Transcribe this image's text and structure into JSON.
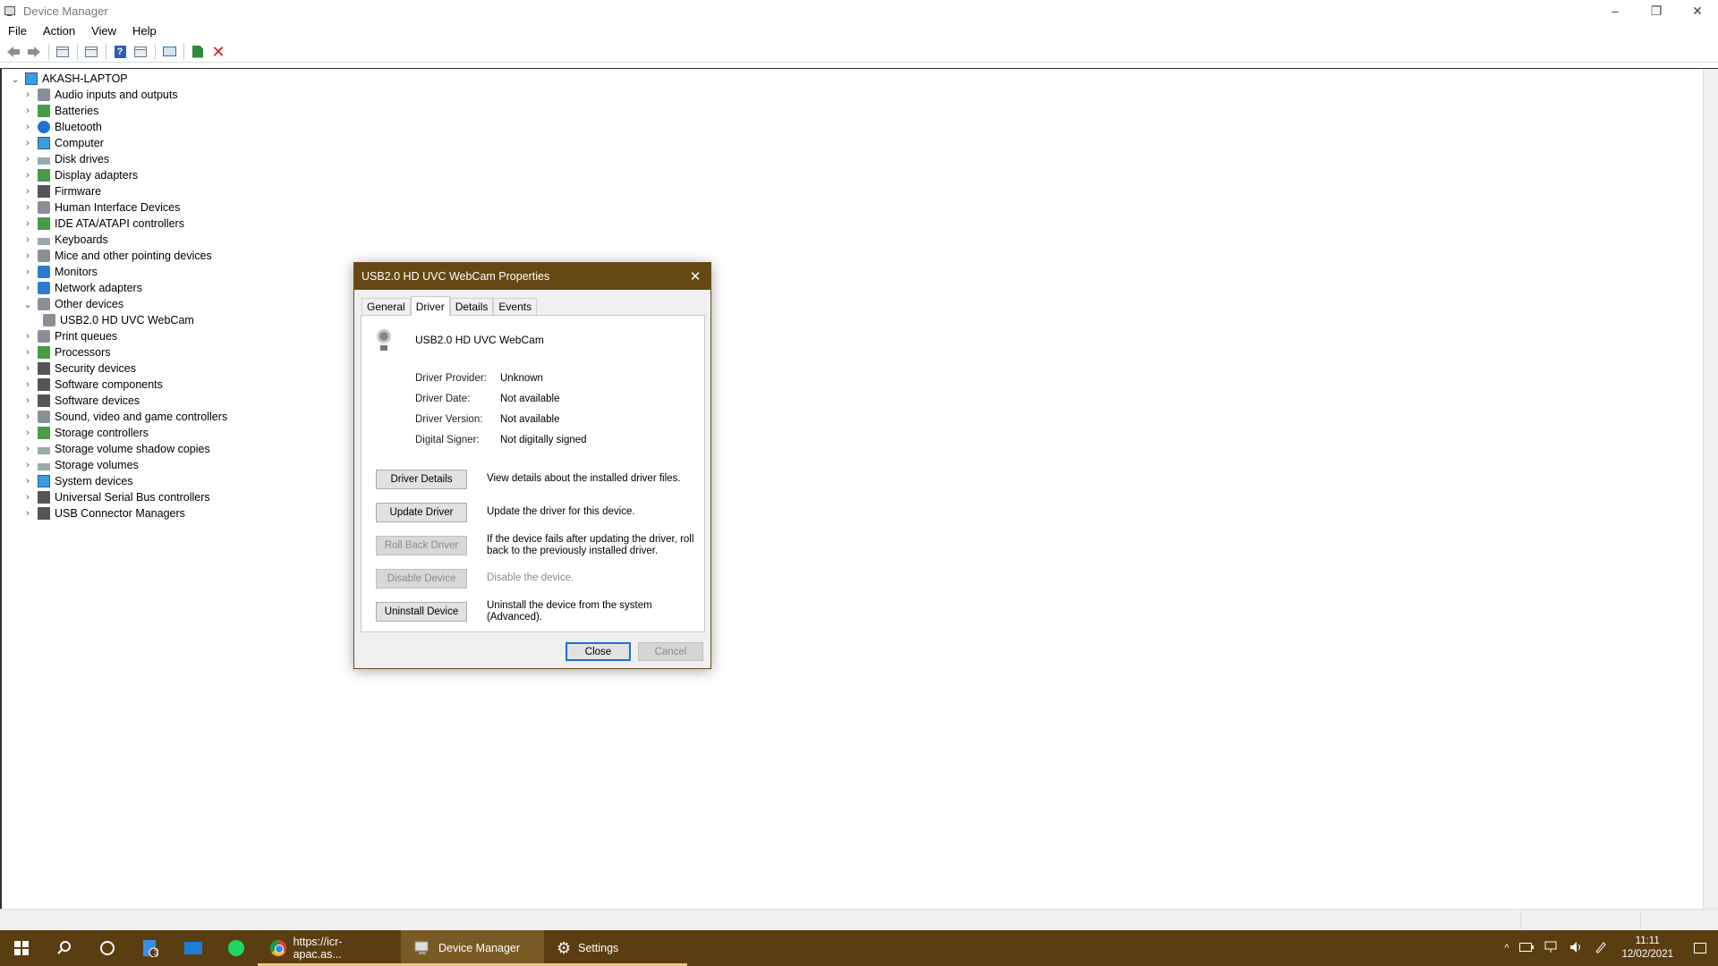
{
  "window": {
    "title": "Device Manager",
    "minimize_icon": "–",
    "maximize_icon": "❐",
    "close_icon": "✕"
  },
  "menu": [
    "File",
    "Action",
    "View",
    "Help"
  ],
  "tree": {
    "root": "AKASH-LAPTOP",
    "items": [
      {
        "label": "Audio inputs and outputs",
        "icon": "speaker-icon"
      },
      {
        "label": "Batteries",
        "icon": "battery-icon"
      },
      {
        "label": "Bluetooth",
        "icon": "bluetooth-icon"
      },
      {
        "label": "Computer",
        "icon": "computer-icon"
      },
      {
        "label": "Disk drives",
        "icon": "disk-icon"
      },
      {
        "label": "Display adapters",
        "icon": "display-adapter-icon"
      },
      {
        "label": "Firmware",
        "icon": "firmware-icon"
      },
      {
        "label": "Human Interface Devices",
        "icon": "hid-icon"
      },
      {
        "label": "IDE ATA/ATAPI controllers",
        "icon": "ide-icon"
      },
      {
        "label": "Keyboards",
        "icon": "keyboard-icon"
      },
      {
        "label": "Mice and other pointing devices",
        "icon": "mouse-icon"
      },
      {
        "label": "Monitors",
        "icon": "monitor-icon"
      },
      {
        "label": "Network adapters",
        "icon": "network-icon"
      },
      {
        "label": "Other devices",
        "icon": "other-devices-icon",
        "expanded": true
      },
      {
        "label": "USB2.0 HD UVC WebCam",
        "icon": "webcam-warning-icon",
        "child": true
      },
      {
        "label": "Print queues",
        "icon": "printer-icon"
      },
      {
        "label": "Processors",
        "icon": "processor-icon"
      },
      {
        "label": "Security devices",
        "icon": "security-icon"
      },
      {
        "label": "Software components",
        "icon": "software-component-icon"
      },
      {
        "label": "Software devices",
        "icon": "software-device-icon"
      },
      {
        "label": "Sound, video and game controllers",
        "icon": "sound-icon"
      },
      {
        "label": "Storage controllers",
        "icon": "storage-controller-icon"
      },
      {
        "label": "Storage volume shadow copies",
        "icon": "shadow-copy-icon"
      },
      {
        "label": "Storage volumes",
        "icon": "storage-volume-icon"
      },
      {
        "label": "System devices",
        "icon": "system-icon"
      },
      {
        "label": "Universal Serial Bus controllers",
        "icon": "usb-icon"
      },
      {
        "label": "USB Connector Managers",
        "icon": "usb-connector-icon"
      }
    ]
  },
  "dialog": {
    "title": "USB2.0 HD UVC WebCam Properties",
    "close_icon": "✕",
    "tabs": [
      "General",
      "Driver",
      "Details",
      "Events"
    ],
    "active_tab": "Driver",
    "device_name": "USB2.0 HD UVC WebCam",
    "properties": [
      {
        "label": "Driver Provider:",
        "value": "Unknown"
      },
      {
        "label": "Driver Date:",
        "value": "Not available"
      },
      {
        "label": "Driver Version:",
        "value": "Not available"
      },
      {
        "label": "Digital Signer:",
        "value": "Not digitally signed"
      }
    ],
    "actions": [
      {
        "label": "Driver Details",
        "desc": "View details about the installed driver files.",
        "enabled": true
      },
      {
        "label": "Update Driver",
        "desc": "Update the driver for this device.",
        "enabled": true
      },
      {
        "label": "Roll Back Driver",
        "desc": "If the device fails after updating the driver, roll back to the previously installed driver.",
        "enabled": false
      },
      {
        "label": "Disable Device",
        "desc": "Disable the device.",
        "enabled": false
      },
      {
        "label": "Uninstall Device",
        "desc": "Uninstall the device from the system (Advanced).",
        "enabled": true
      }
    ],
    "close_label": "Close",
    "cancel_label": "Cancel"
  },
  "taskbar": {
    "mail_badge": "3",
    "chrome_label": "https://icr-apac.as...",
    "device_manager_label": "Device Manager",
    "settings_label": "Settings",
    "settings_icon": "⚙",
    "time": "11:11",
    "date": "12/02/2021",
    "tray_chevron": "^"
  },
  "colors": {
    "accent": "#654813",
    "taskbar": "#5a3e12"
  }
}
